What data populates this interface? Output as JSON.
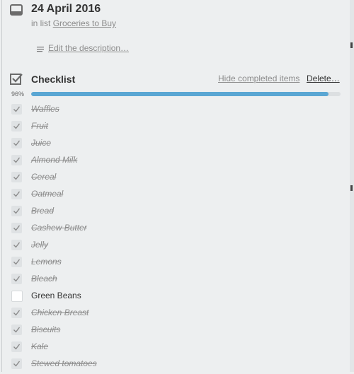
{
  "card": {
    "title": "24 April 2016",
    "list_prefix": "in list",
    "list_name": "Groceries to Buy",
    "description_link": "Edit the description…",
    "icon": "card-icon"
  },
  "checklist": {
    "title": "Checklist",
    "hide_completed": "Hide completed items",
    "delete": "Delete…",
    "progress_label": "96%",
    "progress": 0.96,
    "progress_color": "#5aa6d3",
    "items": [
      {
        "label": "Waffles",
        "checked": true
      },
      {
        "label": "Fruit",
        "checked": true
      },
      {
        "label": "Juice",
        "checked": true
      },
      {
        "label": "Almond Milk",
        "checked": true
      },
      {
        "label": "Cereal",
        "checked": true
      },
      {
        "label": "Oatmeal",
        "checked": true
      },
      {
        "label": "Bread",
        "checked": true
      },
      {
        "label": "Cashew Butter",
        "checked": true
      },
      {
        "label": "Jelly",
        "checked": true
      },
      {
        "label": "Lemons",
        "checked": true
      },
      {
        "label": "Bleach",
        "checked": true
      },
      {
        "label": "Green Beans",
        "checked": false
      },
      {
        "label": "Chicken Breast",
        "checked": true
      },
      {
        "label": "Biscuits",
        "checked": true
      },
      {
        "label": "Kale",
        "checked": true
      },
      {
        "label": "Stewed tomatoes",
        "checked": true
      }
    ]
  }
}
